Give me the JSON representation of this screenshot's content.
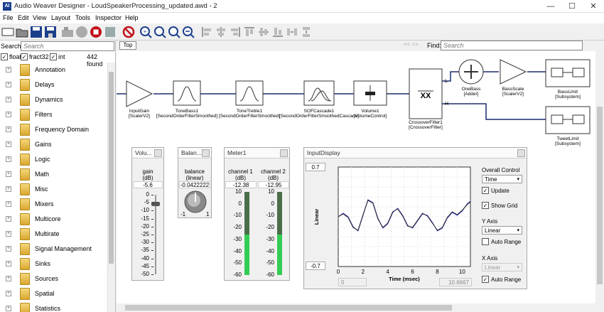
{
  "window": {
    "app_icon": "AI",
    "title": "Audio Weaver Designer - LoudSpeakerProcessing_updated.awd - 2",
    "minimize": "—",
    "maximize": "☐",
    "close": "✕"
  },
  "menu": [
    "File",
    "Edit",
    "View",
    "Layout",
    "Tools",
    "Inspector",
    "Help"
  ],
  "toolbar": {
    "icons": [
      "new-file-icon",
      "open-folder-icon",
      "save-icon",
      "save-as-icon",
      "build-icon",
      "run-icon",
      "stop-icon",
      "separator",
      "no-entry-icon",
      "separator",
      "zoom-in-icon",
      "zoom-100-icon",
      "zoom-fit-icon",
      "zoom-out-icon",
      "separator",
      "align-left-icon",
      "align-center-icon",
      "align-right-icon",
      "align-top-icon",
      "align-middle-icon",
      "align-bottom-icon",
      "distribute-h-icon",
      "distribute-v-icon"
    ]
  },
  "left": {
    "search_label": "Search:",
    "search_placeholder": "Search",
    "filters": [
      {
        "label": "float",
        "checked": true
      },
      {
        "label": "fract32",
        "checked": true
      },
      {
        "label": "int",
        "checked": true
      }
    ],
    "found": "442 found",
    "tree": [
      "Annotation",
      "Delays",
      "Dynamics",
      "Filters",
      "Frequency Domain",
      "Gains",
      "Logic",
      "Math",
      "Misc",
      "Mixers",
      "Multicore",
      "Multirate",
      "Signal Management",
      "Sinks",
      "Sources",
      "Spatial",
      "Statistics"
    ]
  },
  "canvas": {
    "tab": "Top",
    "nav": "<< >>",
    "find_label": "Find:",
    "find_placeholder": "Search",
    "modules": [
      {
        "id": "input-gain",
        "name": "InputGain",
        "type": "[ScalerV2]"
      },
      {
        "id": "tone-bass",
        "name": "ToneBass1",
        "type": "[SecondOrderFilterSmoothed]"
      },
      {
        "id": "tone-treble",
        "name": "ToneTreble1",
        "type": "[SecondOrderFilterSmoothed]"
      },
      {
        "id": "sof-cascade",
        "name": "SOFCascade1",
        "type": "[SecondOrderFilterSmoothedCascade]"
      },
      {
        "id": "volume",
        "name": "Volume1",
        "type": "[VolumeControl]"
      },
      {
        "id": "crossover",
        "name": "CrossoverFilter1",
        "type": "[CrossoverFilter]"
      },
      {
        "id": "one-bass",
        "name": "OneBass",
        "type": "[Adder]"
      },
      {
        "id": "bass-scale",
        "name": "BassScale",
        "type": "[ScalerV2]"
      },
      {
        "id": "bass-limit",
        "name": "BassLimit",
        "type": "[Subsystem]"
      },
      {
        "id": "tweet-limit",
        "name": "TweetLimit",
        "type": "[Subsystem]"
      }
    ],
    "crossover_L": "L",
    "crossover_H": "H"
  },
  "volume_panel": {
    "title": "Volu...",
    "label": "gain",
    "unit": "(dB)",
    "value": "-5.6",
    "level_db": -5.6,
    "ticks": [
      "0",
      "-5",
      "-10",
      "-15",
      "-20",
      "-25",
      "-30",
      "-35",
      "-40",
      "-45",
      "-50"
    ]
  },
  "balance_panel": {
    "title": "Balan...",
    "label": "balance",
    "unit": "(linear)",
    "value": "-0.0422222",
    "min_label": "-1",
    "max_label": "1"
  },
  "meter_panel": {
    "title": "Meter1",
    "channels": [
      {
        "label": "channel 1",
        "unit": "(dB)",
        "value": "-12.38",
        "level_db": -12.38
      },
      {
        "label": "channel 2",
        "unit": "(dB)",
        "value": "-12.95",
        "level_db": -12.95
      }
    ],
    "ticks": [
      "10",
      "0",
      "-10",
      "-20",
      "-30",
      "-40",
      "-50",
      "-60"
    ]
  },
  "input_display": {
    "title": "InputDisplay",
    "y_max": "0.7",
    "y_min": "-0.7",
    "x_min": "0",
    "x_max": "10.6667",
    "overall_control_label": "Overall Control",
    "overall_control_value": "Time",
    "update_label": "Update",
    "update_checked": true,
    "show_grid_label": "Show Grid",
    "show_grid_checked": true,
    "y_axis_label": "Y Axis",
    "y_axis_value": "Linear",
    "y_auto_label": "Auto Range",
    "y_auto_checked": false,
    "x_axis_label": "X Axis",
    "x_axis_value": "Linear",
    "x_auto_label": "Auto Range",
    "x_auto_checked": true,
    "chart_data": {
      "type": "line",
      "xlabel": "Time (msec)",
      "ylabel": "Linear",
      "xlim": [
        0,
        10.6667
      ],
      "ylim": [
        -0.7,
        0.7
      ],
      "grid": true,
      "x_ticks": [
        "0",
        "2",
        "4",
        "6",
        "8",
        "10"
      ],
      "y_ticks": [],
      "x": [
        0,
        0.4,
        0.8,
        1.2,
        1.6,
        2.0,
        2.4,
        2.8,
        3.2,
        3.6,
        4.0,
        4.4,
        4.8,
        5.2,
        5.6,
        6.0,
        6.4,
        6.8,
        7.2,
        7.6,
        8.0,
        8.4,
        8.8,
        9.2,
        9.6,
        10.0,
        10.4,
        10.6667
      ],
      "series": [
        {
          "values": [
            0.0,
            0.05,
            0.0,
            -0.14,
            -0.2,
            0.02,
            0.24,
            0.2,
            -0.02,
            -0.16,
            -0.1,
            0.06,
            0.12,
            0.02,
            -0.12,
            -0.16,
            -0.06,
            0.04,
            0.02,
            -0.08,
            -0.2,
            -0.16,
            -0.02,
            0.06,
            0.02,
            0.08,
            0.18,
            0.22
          ],
          "color": "#3a3ad0"
        },
        {
          "values": [
            0.0,
            0.04,
            -0.01,
            -0.15,
            -0.19,
            0.03,
            0.23,
            0.19,
            -0.03,
            -0.15,
            -0.09,
            0.07,
            0.11,
            0.01,
            -0.13,
            -0.15,
            -0.05,
            0.05,
            0.01,
            -0.09,
            -0.19,
            -0.15,
            -0.01,
            0.07,
            0.03,
            0.09,
            0.17,
            0.21
          ],
          "color": "#222222"
        }
      ]
    }
  },
  "colors": {
    "accent": "#1c3f8c",
    "wire": "#1a2d6e",
    "meter_green": "#33cc55",
    "meter_dark": "#4a6e4a"
  }
}
